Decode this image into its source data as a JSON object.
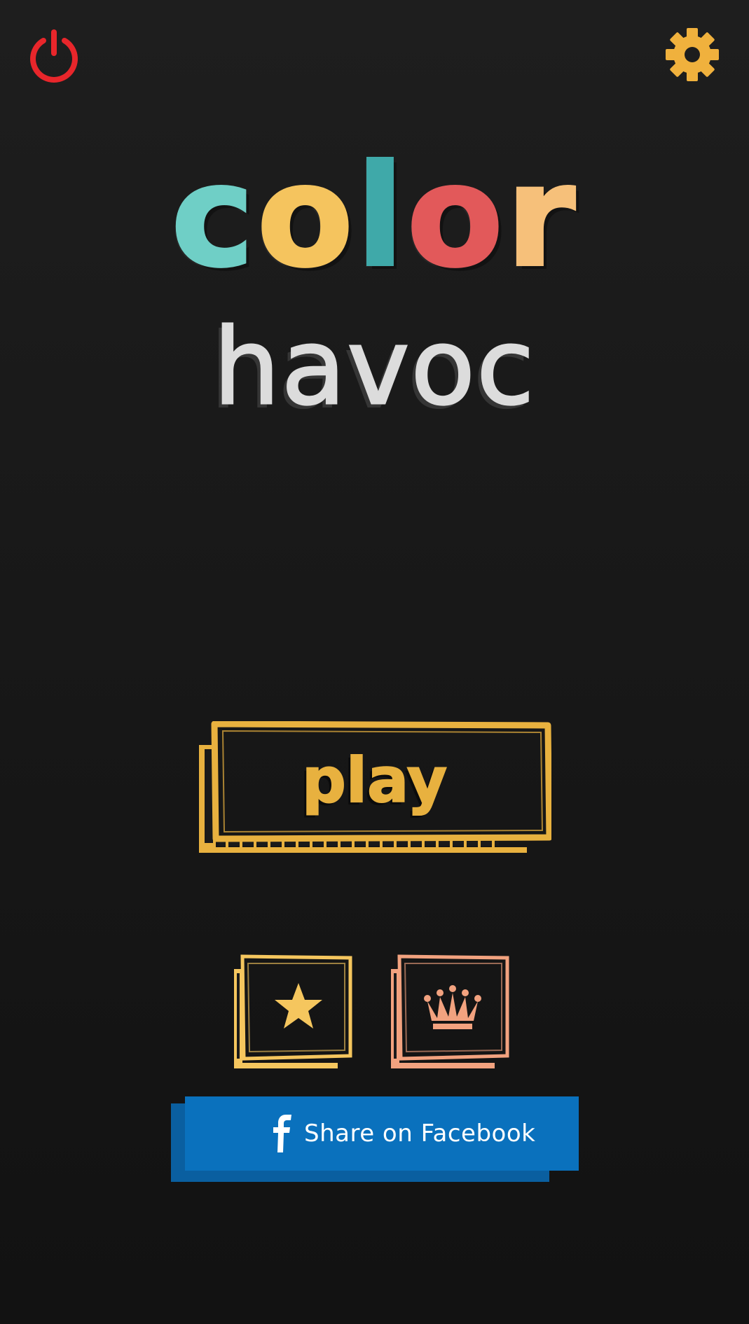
{
  "app": {
    "title_word1_letters": [
      "c",
      "o",
      "l",
      "o",
      "r"
    ],
    "title_word1_colors": [
      "#6fcfc6",
      "#f5c45e",
      "#3fa9a9",
      "#e2595a",
      "#f6c07a"
    ],
    "title_word2": "havoc"
  },
  "header": {
    "power_icon": "power-icon",
    "settings_icon": "gear-icon"
  },
  "menu": {
    "play_label": "play",
    "favorites_icon": "star-icon",
    "leaderboard_icon": "crown-icon"
  },
  "share": {
    "facebook_label": "Share on Facebook",
    "facebook_icon": "facebook-icon"
  },
  "colors": {
    "power": "#e8262b",
    "settings": "#f0b13d",
    "play": "#e8b13f",
    "favorites": "#f5c65e",
    "leaderboard": "#f2a27f",
    "facebook": "#0a71bd",
    "background": "#1b1b1b"
  }
}
